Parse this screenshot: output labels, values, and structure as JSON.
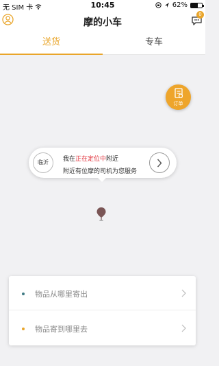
{
  "status_bar": {
    "carrier": "无 SIM 卡",
    "time": "10:45",
    "battery_percent": "62%",
    "battery_level": 0.62
  },
  "header": {
    "title": "摩的小车",
    "message_badge": "0"
  },
  "tabs": [
    {
      "label": "送货",
      "active": true
    },
    {
      "label": "专车",
      "active": false
    }
  ],
  "order_button": {
    "label": "订单"
  },
  "location_bubble": {
    "city": "临沂",
    "line1_prefix": "我在",
    "line1_highlight": "正在定位中",
    "line1_suffix": "附近",
    "line2": "附近有位摩的司机为您服务"
  },
  "address_card": {
    "from_placeholder": "物品从哪里寄出",
    "to_placeholder": "物品寄到哪里去"
  },
  "colors": {
    "accent": "#e9a52a",
    "highlight_red": "#e0303a",
    "from_dot": "#3f7a84"
  }
}
